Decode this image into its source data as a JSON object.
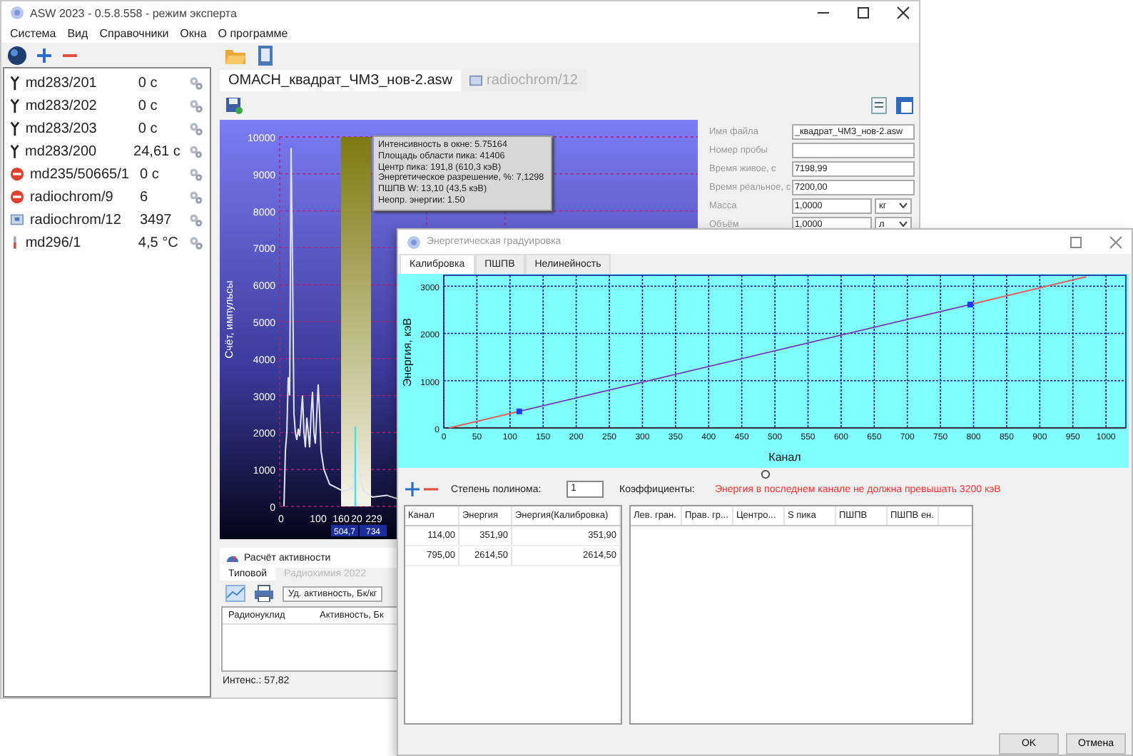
{
  "window": {
    "title": "ASW 2023 - 0.5.8.558 - режим эксперта"
  },
  "menu": [
    "Система",
    "Вид",
    "Справочники",
    "Окна",
    "О программе"
  ],
  "devices": [
    {
      "kind": "antenna",
      "name": "md283/201",
      "value": "0 с"
    },
    {
      "kind": "antenna",
      "name": "md283/202",
      "value": "0 с"
    },
    {
      "kind": "antenna",
      "name": "md283/203",
      "value": "0 с"
    },
    {
      "kind": "antenna",
      "name": "md283/200",
      "value": "24,61 с"
    },
    {
      "kind": "stop",
      "name": "md235/50665/1",
      "value": "0 с"
    },
    {
      "kind": "stop",
      "name": "radiochrom/9",
      "value": "6"
    },
    {
      "kind": "monitor",
      "name": "radiochrom/12",
      "value": "3497"
    },
    {
      "kind": "thermometer",
      "name": "md296/1",
      "value": "4,5 °C"
    }
  ],
  "document_tabs": [
    {
      "label": "ОМАСН_квадрат_ЧМЗ_нов-2.asw",
      "selected": true
    },
    {
      "label": "radiochrom/12",
      "selected": false
    }
  ],
  "spectrum": {
    "ylabel": "Счёт, импульсы",
    "yticks": [
      "10000",
      "9000",
      "8000",
      "7000",
      "6000",
      "5000",
      "4000",
      "3000",
      "2000",
      "1000",
      "0"
    ],
    "xticks": [
      "0",
      "100",
      "160",
      "20",
      "229"
    ],
    "markers": [
      "504,7",
      "734"
    ],
    "tooltip": [
      "Интенсивность в окне: 5.75164",
      "Площадь области пика: 41406",
      "Центр пика: 191,8 (610,3 кэВ)",
      "Энергетическое разрешение, %: 7,1298",
      "ПШПВ W: 13,10 (43,5 кэВ)",
      "Неопр. энергии: 1.50"
    ]
  },
  "properties": [
    {
      "label": "Имя файла",
      "value": "_квадрат_ЧМЗ_нов-2.asw"
    },
    {
      "label": "Номер пробы"
    },
    {
      "label": "Время живое, с",
      "value": "7198,99"
    },
    {
      "label": "Время реальное, с",
      "value": "7200,00"
    },
    {
      "label": "Масса",
      "value": "1,0000",
      "unit": "кг"
    },
    {
      "label": "Объём",
      "value": "1,0000",
      "unit": "л"
    }
  ],
  "activity": {
    "title": "Расчёт активности",
    "tabs": [
      {
        "label": "Типовой",
        "selected": true
      },
      {
        "label": "Радиохимия 2022",
        "selected": false
      }
    ],
    "unit_select": "Уд. активность, Бк/кг",
    "columns": [
      "Радионуклид",
      "Активность, Бк"
    ]
  },
  "status": "Интенс.: 57,82",
  "dialog": {
    "title": "Энергетическая градуировка",
    "tabs": [
      {
        "label": "Калибровка",
        "selected": true
      },
      {
        "label": "ПШПВ",
        "selected": false
      },
      {
        "label": "Нелинейность",
        "selected": false
      }
    ],
    "chart_data": {
      "type": "line",
      "xlabel": "Канал",
      "ylabel": "Энергия, кэВ",
      "x": [
        8,
        114,
        795,
        970
      ],
      "series": [
        {
          "color": "#e06060",
          "values": [
            0,
            350,
            2610,
            3200
          ]
        },
        {
          "color": "#1a3cff",
          "marker": "square",
          "values": [
            null,
            350,
            2610,
            null
          ]
        }
      ],
      "grid": true,
      "xlim": [
        0,
        1030
      ],
      "ylim": [
        0,
        3230
      ],
      "xticks": [
        0,
        50,
        100,
        150,
        200,
        250,
        300,
        350,
        400,
        450,
        500,
        550,
        600,
        650,
        700,
        750,
        800,
        850,
        900,
        950,
        1000
      ],
      "yticks": [
        0,
        1000,
        2000,
        3000
      ]
    },
    "polynomial_label": "Степень полинома:",
    "polynomial_value": "1",
    "coefficients_label": "Коэффициенты:",
    "warning": "Энергия в последнем канале не должна превышать 3200 кэВ",
    "points_table": {
      "columns": [
        "Канал",
        "Энергия",
        "Энергия(Калибровка)"
      ],
      "rows": [
        [
          "114,00",
          "351,90",
          "351,90"
        ],
        [
          "795,00",
          "2614,50",
          "2614,50"
        ]
      ]
    },
    "peaks_table": {
      "columns": [
        "Лев. гран.",
        "Прав. гр...",
        "Центро...",
        "S пика",
        "ПШПВ",
        "ПШПВ ен."
      ]
    },
    "buttons": [
      "OK",
      "Отмена"
    ]
  }
}
